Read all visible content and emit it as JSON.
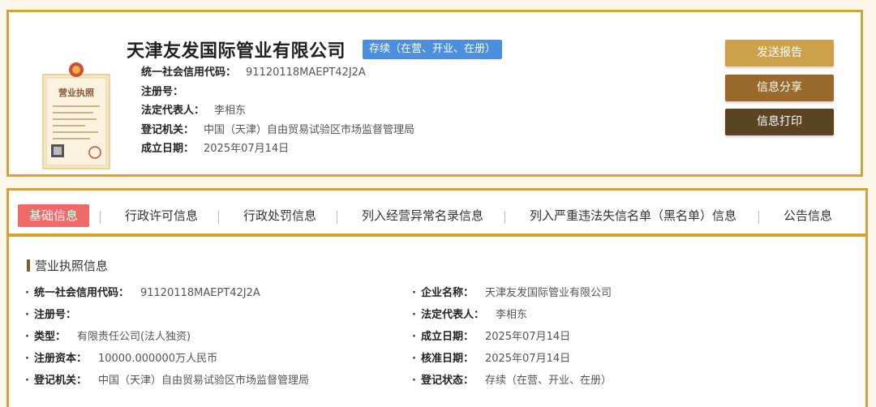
{
  "header": {
    "company_name": "天津友发国际管业有限公司",
    "status": "存续（在营、开业、在册）",
    "fields": [
      {
        "label": "统一社会信用代码：",
        "value": "91120118MAEPT42J2A"
      },
      {
        "label": "注册号：",
        "value": ""
      },
      {
        "label": "法定代表人：",
        "value": "李相东"
      },
      {
        "label": "登记机关：",
        "value": "中国（天津）自由贸易试验区市场监督管理局"
      },
      {
        "label": "成立日期：",
        "value": "2025年07月14日"
      }
    ],
    "license_title": "营业执照"
  },
  "actions": {
    "send_report": "发送报告",
    "share": "信息分享",
    "print": "信息打印"
  },
  "tabs": [
    {
      "label": "基础信息",
      "active": true
    },
    {
      "label": "行政许可信息"
    },
    {
      "label": "行政处罚信息"
    },
    {
      "label": "列入经营异常名录信息"
    },
    {
      "label": "列入严重违法失信名单（黑名单）信息"
    },
    {
      "label": "公告信息"
    }
  ],
  "section": {
    "title": "营业执照信息",
    "left": [
      {
        "label": "统一社会信用代码：",
        "value": "91120118MAEPT42J2A"
      },
      {
        "label": "注册号：",
        "value": ""
      },
      {
        "label": "类型：",
        "value": "有限责任公司(法人独资)"
      },
      {
        "label": "注册资本：",
        "value": "10000.000000万人民币"
      },
      {
        "label": "登记机关：",
        "value": "中国（天津）自由贸易试验区市场监督管理局"
      }
    ],
    "right": [
      {
        "label": "企业名称：",
        "value": "天津友发国际管业有限公司"
      },
      {
        "label": "法定代表人：",
        "value": "李相东"
      },
      {
        "label": "成立日期：",
        "value": "2025年07月14日"
      },
      {
        "label": "核准日期：",
        "value": "2025年07月14日"
      },
      {
        "label": "登记状态：",
        "value": "存续（在营、开业、在册）"
      }
    ]
  }
}
